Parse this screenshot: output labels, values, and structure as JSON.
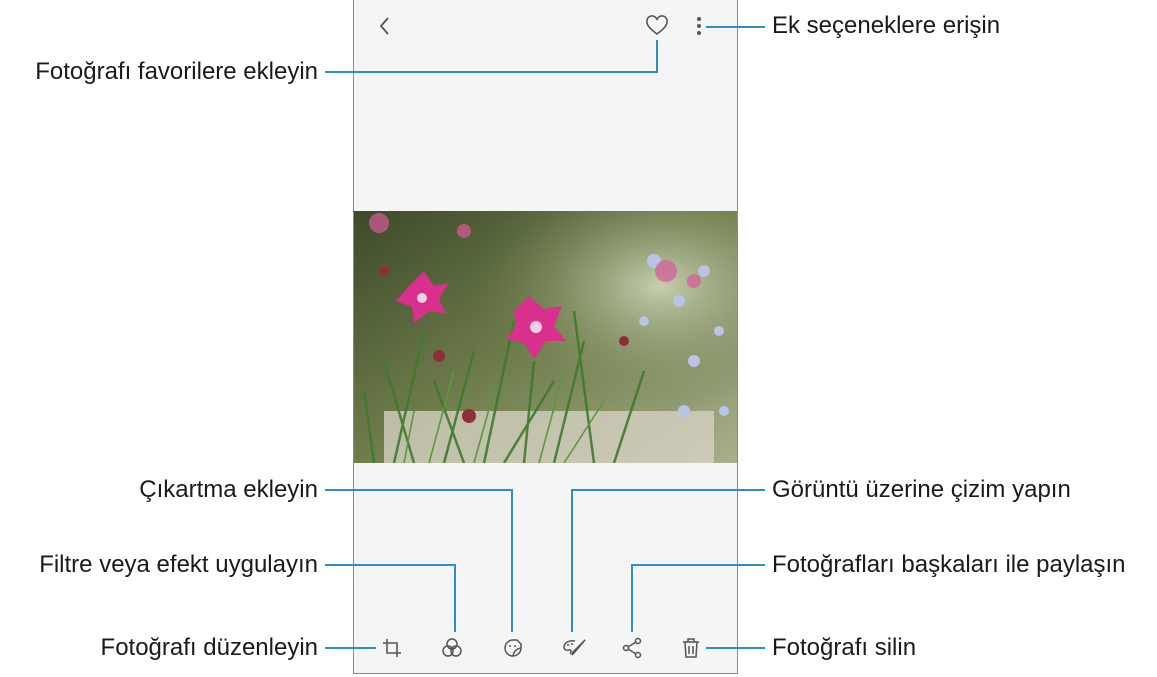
{
  "callouts": {
    "more_options": "Ek seçeneklere erişin",
    "favorite": "Fotoğrafı favorilere ekleyin",
    "sticker": "Çıkartma ekleyin",
    "draw": "Görüntü üzerine çizim yapın",
    "filter": "Filtre veya efekt uygulayın",
    "share": "Fotoğrafları başkaları ile paylaşın",
    "edit": "Fotoğrafı düzenleyin",
    "delete": "Fotoğrafı silin"
  },
  "colors": {
    "callout_line": "#2d8fc9",
    "icon": "#555555",
    "screen_bg": "#f5f5f5"
  },
  "icons": [
    "back-icon",
    "favorite-heart-icon",
    "more-options-icon",
    "crop-edit-icon",
    "filter-effects-icon",
    "sticker-icon",
    "draw-brush-icon",
    "share-icon",
    "delete-trash-icon"
  ]
}
